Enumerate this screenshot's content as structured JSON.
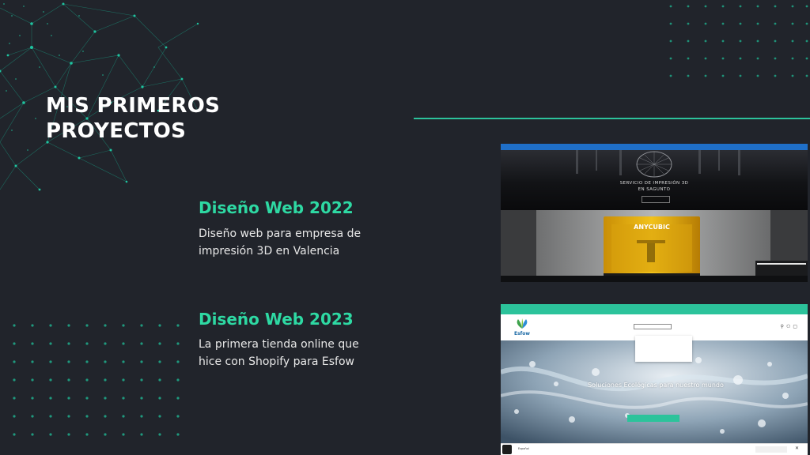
{
  "slide": {
    "title_line1": "MIS PRIMEROS",
    "title_line2": "PROYECTOS"
  },
  "projects": [
    {
      "title": "Diseño Web 2022",
      "desc_line1": "Diseño web para empresa de",
      "desc_line2": "impresión 3D en Valencia"
    },
    {
      "title": "Diseño Web 2023",
      "desc_line1": "La primera tienda online que",
      "desc_line2": "hice con Shopify para Esfow"
    }
  ],
  "shot1": {
    "hero_line1": "SERVICIO DE IMPRESIÓN 3D",
    "hero_line2": "EN SAGUNTO",
    "printer_brand": "ANYCUBIC"
  },
  "shot2": {
    "logo": "Esfow",
    "banner_title": "Soluciones Ecológicas para nuestro mundo",
    "lang": "Español"
  },
  "colors": {
    "background": "#21242b",
    "accent": "#2ed9a3",
    "line": "#2cc39b"
  }
}
